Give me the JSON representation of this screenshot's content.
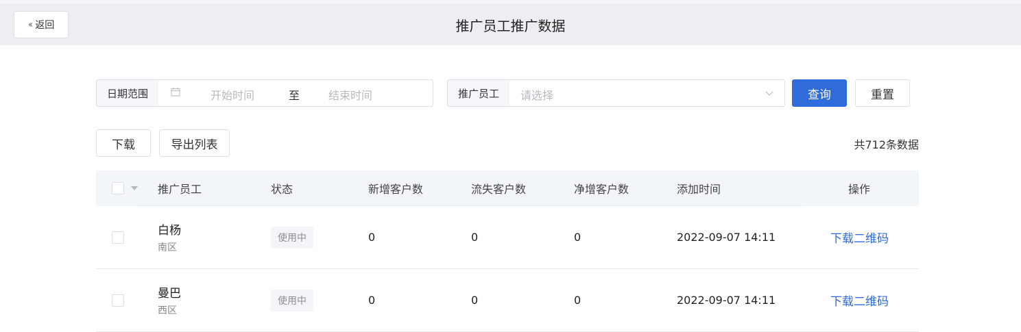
{
  "header": {
    "back_label": "返回",
    "title": "推广员工推广数据"
  },
  "filters": {
    "date_range_label": "日期范围",
    "start_placeholder": "开始时间",
    "separator": "至",
    "end_placeholder": "结束时间",
    "employee_label": "推广员工",
    "employee_placeholder": "请选择",
    "query_label": "查询",
    "reset_label": "重置"
  },
  "actions": {
    "download_label": "下载",
    "export_label": "导出列表",
    "total_text": "共712条数据"
  },
  "table": {
    "columns": [
      "推广员工",
      "状态",
      "新增客户数",
      "流失客户数",
      "净增客户数",
      "添加时间",
      "操作"
    ],
    "rows": [
      {
        "name": "白杨",
        "region": "南区",
        "status": "使用中",
        "new": "0",
        "lost": "0",
        "net": "0",
        "added": "2022-09-07 14:11",
        "action": "下载二维码"
      },
      {
        "name": "曼巴",
        "region": "西区",
        "status": "使用中",
        "new": "0",
        "lost": "0",
        "net": "0",
        "added": "2022-09-07 14:11",
        "action": "下载二维码"
      }
    ]
  },
  "colors": {
    "primary": "#2f6bdb",
    "header_bg": "#edeef1",
    "table_head_bg": "#f3f6f9"
  }
}
